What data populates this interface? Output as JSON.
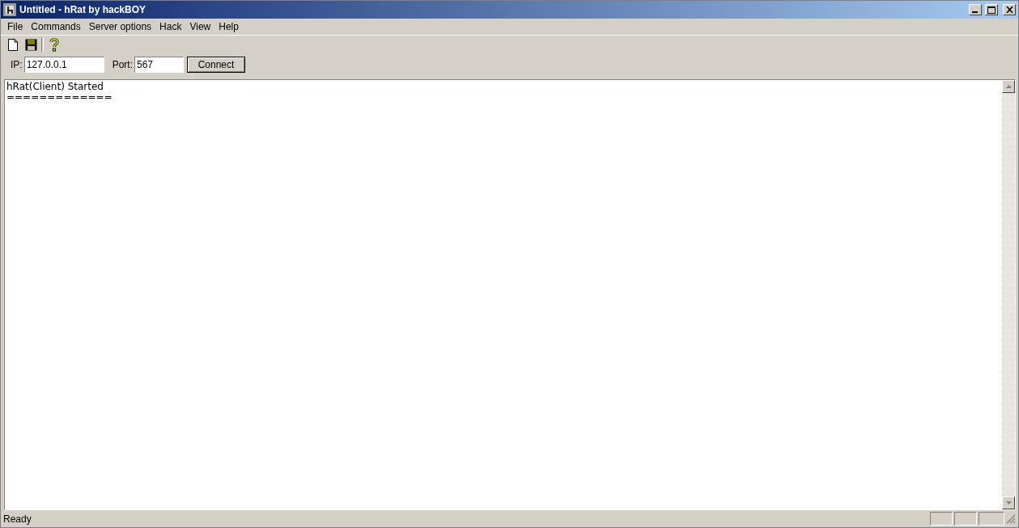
{
  "window": {
    "title": "Untitled - hRat by hackBOY"
  },
  "menu": [
    "File",
    "Commands",
    "Server options",
    "Hack",
    "View",
    "Help"
  ],
  "connection": {
    "ip_label": "IP:",
    "ip": "127.0.0.1",
    "port_label": "Port:",
    "port": "567",
    "button": "Connect"
  },
  "log": [
    "hRat(Client) Started",
    "============="
  ],
  "status_bar": {
    "text": "Ready"
  }
}
